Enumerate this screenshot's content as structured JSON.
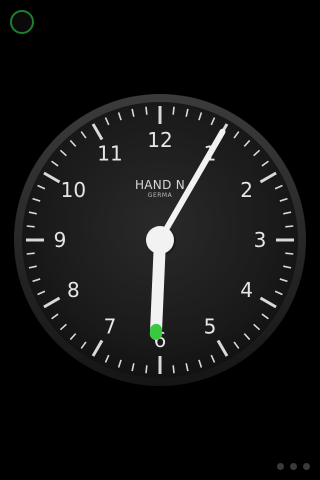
{
  "status": {
    "indicator_icon": "circle-icon",
    "indicator_color": "#1f7f2c"
  },
  "clock": {
    "brand": "HAND N",
    "brand_sub": "GERMA",
    "numerals": [
      "12",
      "1",
      "2",
      "3",
      "4",
      "5",
      "6",
      "7",
      "8",
      "9",
      "10",
      "11"
    ],
    "time": {
      "hour": 6,
      "minute": 5
    },
    "colors": {
      "face": "#1a1a1a",
      "bezel": "#2a2a2a",
      "ticks": "#d9d9d9",
      "hands": "#f2f2f2",
      "hour_hand_tip": "#39c93f"
    }
  },
  "pager": {
    "dots": 3
  }
}
